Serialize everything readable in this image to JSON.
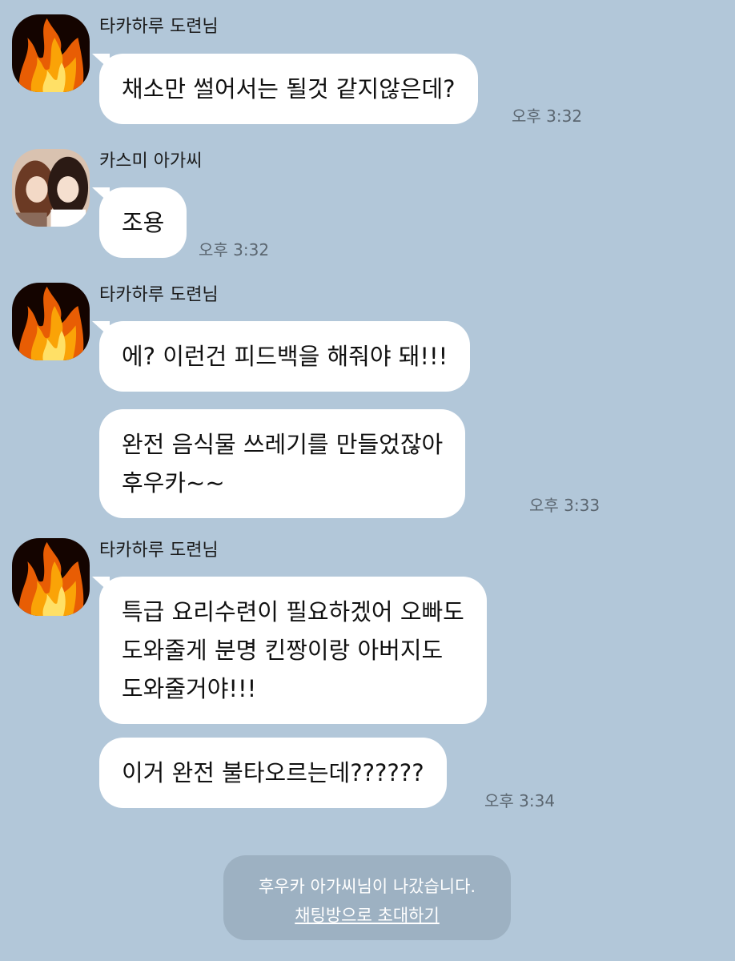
{
  "messages": [
    {
      "sender": "타카하루 도련님",
      "avatar": "fire-avatar",
      "bubbles": [
        "채소만 썰어서는 될것 같지않은데?"
      ],
      "time": "오후 3:32"
    },
    {
      "sender": "카스미 아가씨",
      "avatar": "photo-avatar",
      "bubbles": [
        "조용"
      ],
      "time": "오후 3:32"
    },
    {
      "sender": "타카하루 도련님",
      "avatar": "fire-avatar",
      "bubbles": [
        "에? 이런건 피드백을 해줘야 돼!!!",
        [
          "완전 음식물 쓰레기를 만들었잖아",
          "후우카~~"
        ]
      ],
      "time": "오후 3:33"
    },
    {
      "sender": "타카하루 도련님",
      "avatar": "fire-avatar",
      "bubbles": [
        [
          "특급 요리수련이 필요하겠어 오빠도",
          "도와줄게 분명 킨짱이랑 아버지도",
          "도와줄거야!!!"
        ],
        "이거 완전 불타오르는데??????"
      ],
      "time": "오후 3:34"
    }
  ],
  "notice": {
    "text": "후우카 아가씨님이 나갔습니다.",
    "link": "채팅방으로 초대하기"
  },
  "colors": {
    "background": "#b2c7d9",
    "bubble": "#ffffff",
    "notice_bg": "#9db1c2"
  }
}
